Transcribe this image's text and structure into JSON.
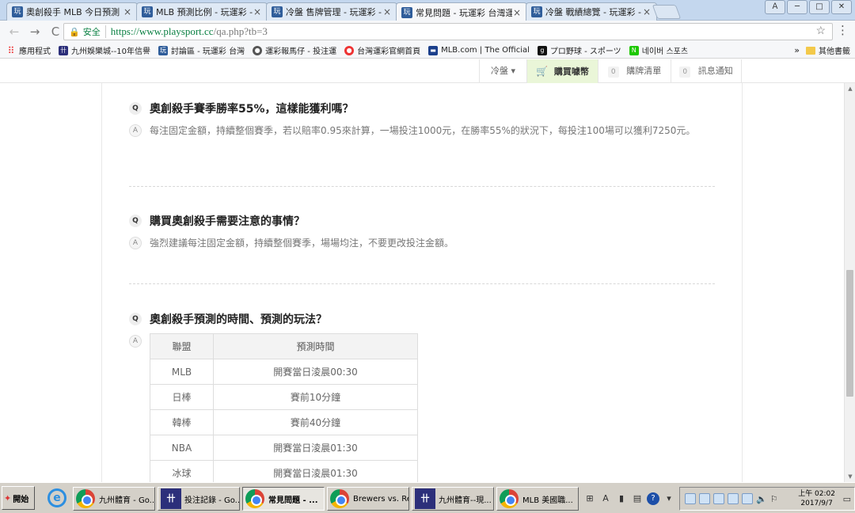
{
  "browser": {
    "tabs": [
      {
        "label": "奧創殺手 MLB 今日預測",
        "icon": "玩"
      },
      {
        "label": "MLB 預測比例 - 玩運彩 -",
        "icon": "玩"
      },
      {
        "label": "冷盤 售牌管理 - 玩運彩 -",
        "icon": "玩"
      },
      {
        "label": "常見問題 - 玩運彩 台灣運",
        "icon": "玩"
      },
      {
        "label": "冷盤 戰績總覽 - 玩運彩 -",
        "icon": "玩"
      }
    ],
    "tab_close": "×",
    "active_tab_index": 3,
    "window_controls": [
      "Ａ",
      "─",
      "□",
      "✕"
    ],
    "nav": {
      "back": "←",
      "forward": "→",
      "reload": "C"
    },
    "secure_label": "安全",
    "url_host": "https://www.playsport.cc",
    "url_rest": "/qa.php?tb=3",
    "bookmarks": [
      {
        "label": "應用程式",
        "icon": "apps-icon",
        "glyph": "⠿",
        "color": "#e33"
      },
      {
        "label": "九州娛樂城--10年信譽",
        "icon": "jiuzhou-icon",
        "glyph": "卄",
        "color": "#2c2f7a"
      },
      {
        "label": "討論區 - 玩運彩 台灣",
        "icon": "playsport-icon",
        "glyph": "玩",
        "color": "#2f5d9a"
      },
      {
        "label": "運彩報馬仔 - 投注運",
        "icon": "baomazai-icon",
        "glyph": "●",
        "color": "#555"
      },
      {
        "label": "台灣運彩官網首頁",
        "icon": "sportslottery-icon",
        "glyph": "●",
        "color": "#e33"
      },
      {
        "label": "MLB.com | The Official",
        "icon": "mlb-icon",
        "glyph": "▬",
        "color": "#1b3f8b"
      },
      {
        "label": "プロ野球 - スポーツ",
        "icon": "gracenote-icon",
        "glyph": "g",
        "color": "#111"
      },
      {
        "label": "네이버 스포츠",
        "icon": "naver-icon",
        "glyph": "N",
        "color": "#1ec800"
      }
    ],
    "bookmarks_more": "»",
    "bookmarks_other": "其他書籤"
  },
  "site_header": {
    "region": "冷盤",
    "region_caret": "▾",
    "buy": "購買噱幣",
    "cart_list": "購牌清單",
    "cart_count": "0",
    "messages": "訊息通知",
    "message_count": "0"
  },
  "faq": [
    {
      "q_mark": "Q",
      "question": "奧創殺手賽季勝率55%，這樣能獲利嗎？",
      "a_mark": "A",
      "answer": "每注固定金額，持續整個賽季，若以賠率0.95來計算，一場投注1000元，在勝率55%的狀況下，每投注100場可以獲利7250元。"
    },
    {
      "q_mark": "Q",
      "question": "購買奧創殺手需要注意的事情？",
      "a_mark": "A",
      "answer": "強烈建議每注固定金額，持續整個賽季，場場均注，不要更改投注金額。"
    },
    {
      "q_mark": "Q",
      "question": "奧創殺手預測的時間、預測的玩法？",
      "a_mark": "A",
      "answer": ""
    }
  ],
  "schedule": {
    "headers": [
      "聯盟",
      "預測時間"
    ],
    "rows": [
      [
        "MLB",
        "開賽當日淩晨00:30"
      ],
      [
        "日棒",
        "賽前10分鐘"
      ],
      [
        "韓棒",
        "賽前40分鐘"
      ],
      [
        "NBA",
        "開賽當日淩晨01:30"
      ],
      [
        "冰球",
        "開賽當日淩晨01:30"
      ]
    ]
  },
  "taskbar": {
    "start": "開始",
    "tasks": [
      {
        "label": "九州體育 - Go...",
        "icon": "chrome"
      },
      {
        "label": "投注記錄 - Go...",
        "icon": "jiuzhou"
      },
      {
        "label": "常見問題 - ...",
        "icon": "chrome"
      },
      {
        "label": "Brewers vs. Re...",
        "icon": "chrome"
      },
      {
        "label": "九州體育--現...",
        "icon": "jiuzhou"
      },
      {
        "label": "MLB 美國職...",
        "icon": "chrome"
      }
    ],
    "active_task_index": 2,
    "clock_time": "上午 02:02",
    "clock_date": "2017/9/7"
  }
}
